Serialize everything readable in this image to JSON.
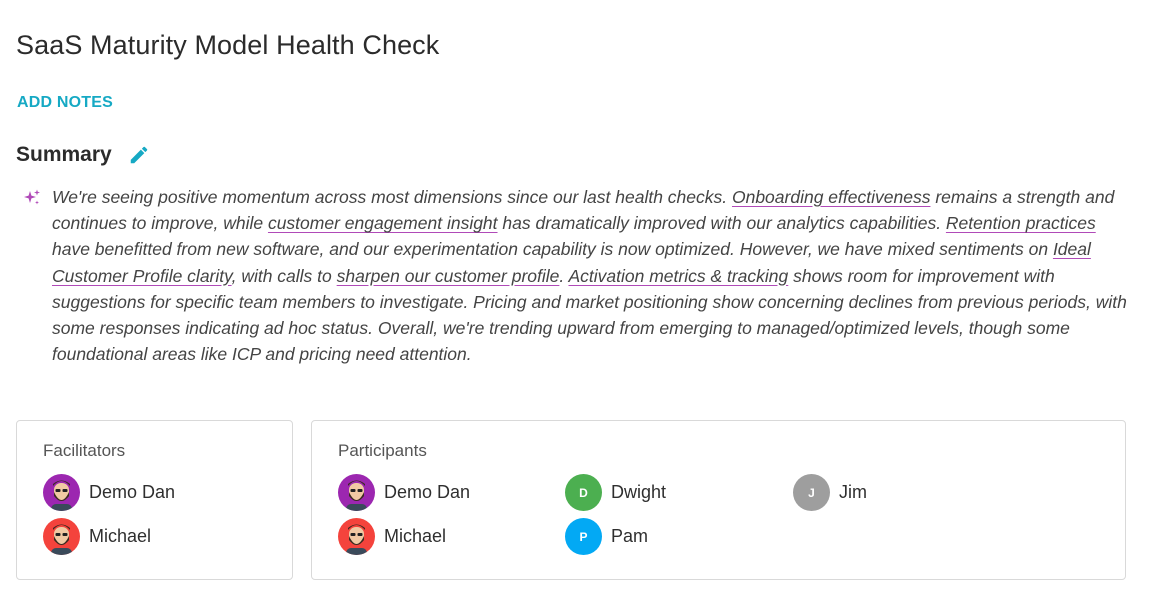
{
  "page": {
    "title": "SaaS Maturity Model Health Check",
    "add_notes_label": "ADD NOTES"
  },
  "summary": {
    "heading": "Summary",
    "edit_icon": "pencil-icon",
    "ai_icon": "sparkle-icon",
    "accent_color": "#16a9c4",
    "highlight_color": "#b04ab8",
    "segments": [
      {
        "text": "We're seeing positive momentum across most dimensions since our last health checks. ",
        "link": false
      },
      {
        "text": "Onboarding effectiveness",
        "link": true
      },
      {
        "text": " remains a strength and continues to improve, while ",
        "link": false
      },
      {
        "text": "customer engagement insight",
        "link": true
      },
      {
        "text": " has dramatically improved with our analytics capabilities. ",
        "link": false
      },
      {
        "text": "Retention practices",
        "link": true
      },
      {
        "text": " have benefitted from new software, and our experimentation capability is now optimized. However, we have mixed sentiments on ",
        "link": false
      },
      {
        "text": "Ideal Customer Profile clarity",
        "link": true
      },
      {
        "text": ", with calls to ",
        "link": false
      },
      {
        "text": "sharpen our customer profile",
        "link": true
      },
      {
        "text": ". ",
        "link": false
      },
      {
        "text": "Activation metrics & tracking",
        "link": true
      },
      {
        "text": " shows room for improvement with suggestions for specific team members to investigate. Pricing and market positioning show concerning declines from previous periods, with some responses indicating ad hoc status. Overall, we're trending upward from emerging to managed/optimized levels, though some foundational areas like ICP and pricing need attention.",
        "link": false
      }
    ]
  },
  "facilitators": {
    "title": "Facilitators",
    "people": [
      {
        "name": "Demo Dan",
        "avatar": "bearded-man-avatar",
        "color": "#9c27b0"
      },
      {
        "name": "Michael",
        "avatar": "bearded-man-avatar",
        "color": "#f4433c"
      }
    ]
  },
  "participants": {
    "title": "Participants",
    "people": [
      {
        "name": "Demo Dan",
        "avatar": "bearded-man-avatar",
        "color": "#9c27b0"
      },
      {
        "name": "Michael",
        "avatar": "bearded-man-avatar",
        "color": "#f4433c"
      },
      {
        "name": "Dwight",
        "initial": "D",
        "color": "#4caf50"
      },
      {
        "name": "Pam",
        "initial": "P",
        "color": "#03a9f4"
      },
      {
        "name": "Jim",
        "initial": "J",
        "color": "#9e9e9e"
      }
    ]
  }
}
